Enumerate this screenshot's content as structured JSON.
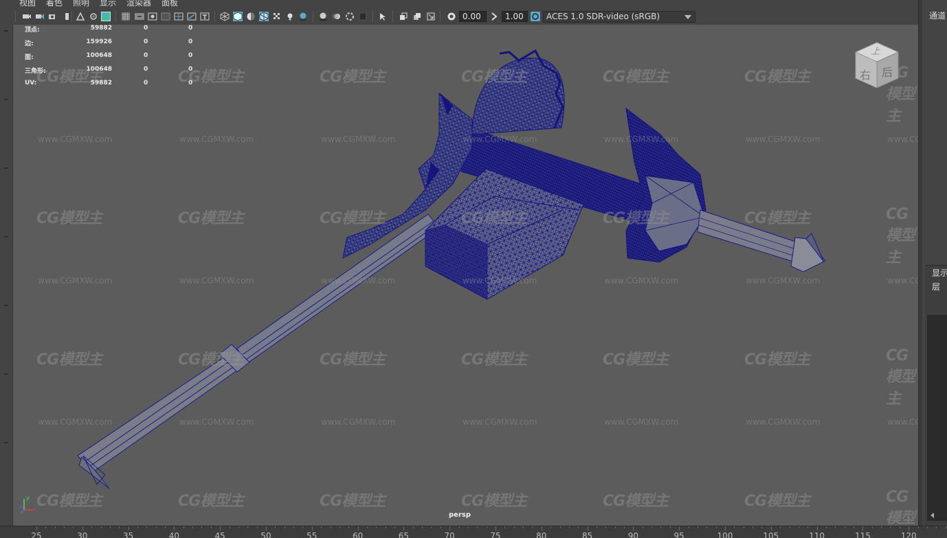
{
  "menu": [
    "视图",
    "着色",
    "照明",
    "显示",
    "渲染器",
    "面板"
  ],
  "toolbar": {
    "exposure_value": "0.00",
    "gamma_value": "1.00",
    "color_management": "ACES 1.0 SDR-video (sRGB)"
  },
  "hud": {
    "rows": [
      {
        "label": "顶点:",
        "v1": "59882",
        "v2": "0",
        "v3": "0"
      },
      {
        "label": "边:",
        "v1": "159926",
        "v2": "0",
        "v3": "0"
      },
      {
        "label": "面:",
        "v1": "100648",
        "v2": "0",
        "v3": "0"
      },
      {
        "label": "三角形:",
        "v1": "100648",
        "v2": "0",
        "v3": "0"
      },
      {
        "label": "UV:",
        "v1": "59882",
        "v2": "0",
        "v3": "0"
      }
    ]
  },
  "watermark": {
    "logo": "CG模型主",
    "url": "www.CGMXW.com"
  },
  "view_cube": {
    "top": "上",
    "front": "右",
    "side": "后"
  },
  "camera": "persp",
  "axis": {
    "x": "x",
    "y": "y",
    "z": "z"
  },
  "right_panel": {
    "channels": "通道",
    "display": "显示",
    "layer": "层"
  },
  "time_slider": {
    "frames": [
      "25",
      "30",
      "35",
      "40",
      "45",
      "50",
      "55",
      "60",
      "65",
      "70",
      "75",
      "80",
      "85",
      "90",
      "95",
      "100",
      "105",
      "110",
      "115",
      "120"
    ]
  },
  "colors": {
    "wire": "#1a1a8a",
    "viewport": "#5c5c5c",
    "accent": "#5fa8c8"
  },
  "icons": [
    "camera-icon",
    "select-camera-icon",
    "lock-camera-icon",
    "bookmark-icon",
    "move-icon",
    "snap-icon",
    "pencil-icon",
    "grid-icon",
    "film-gate-icon",
    "resolution-gate-icon",
    "gate-mask-icon",
    "field-chart-icon",
    "safe-action-icon",
    "safe-title-icon",
    "wireframe-icon",
    "smooth-shade-icon",
    "flat-shade-icon",
    "wire-on-shaded-icon",
    "textured-icon",
    "lights-icon",
    "shadows-icon",
    "ambient-occlusion-icon",
    "motion-blur-icon",
    "anti-alias-icon",
    "depth-of-field-icon",
    "isolate-select-icon",
    "xray-icon",
    "xray-joints-icon",
    "backface-icon",
    "exposure-icon",
    "gamma-icon",
    "color-management-icon"
  ]
}
